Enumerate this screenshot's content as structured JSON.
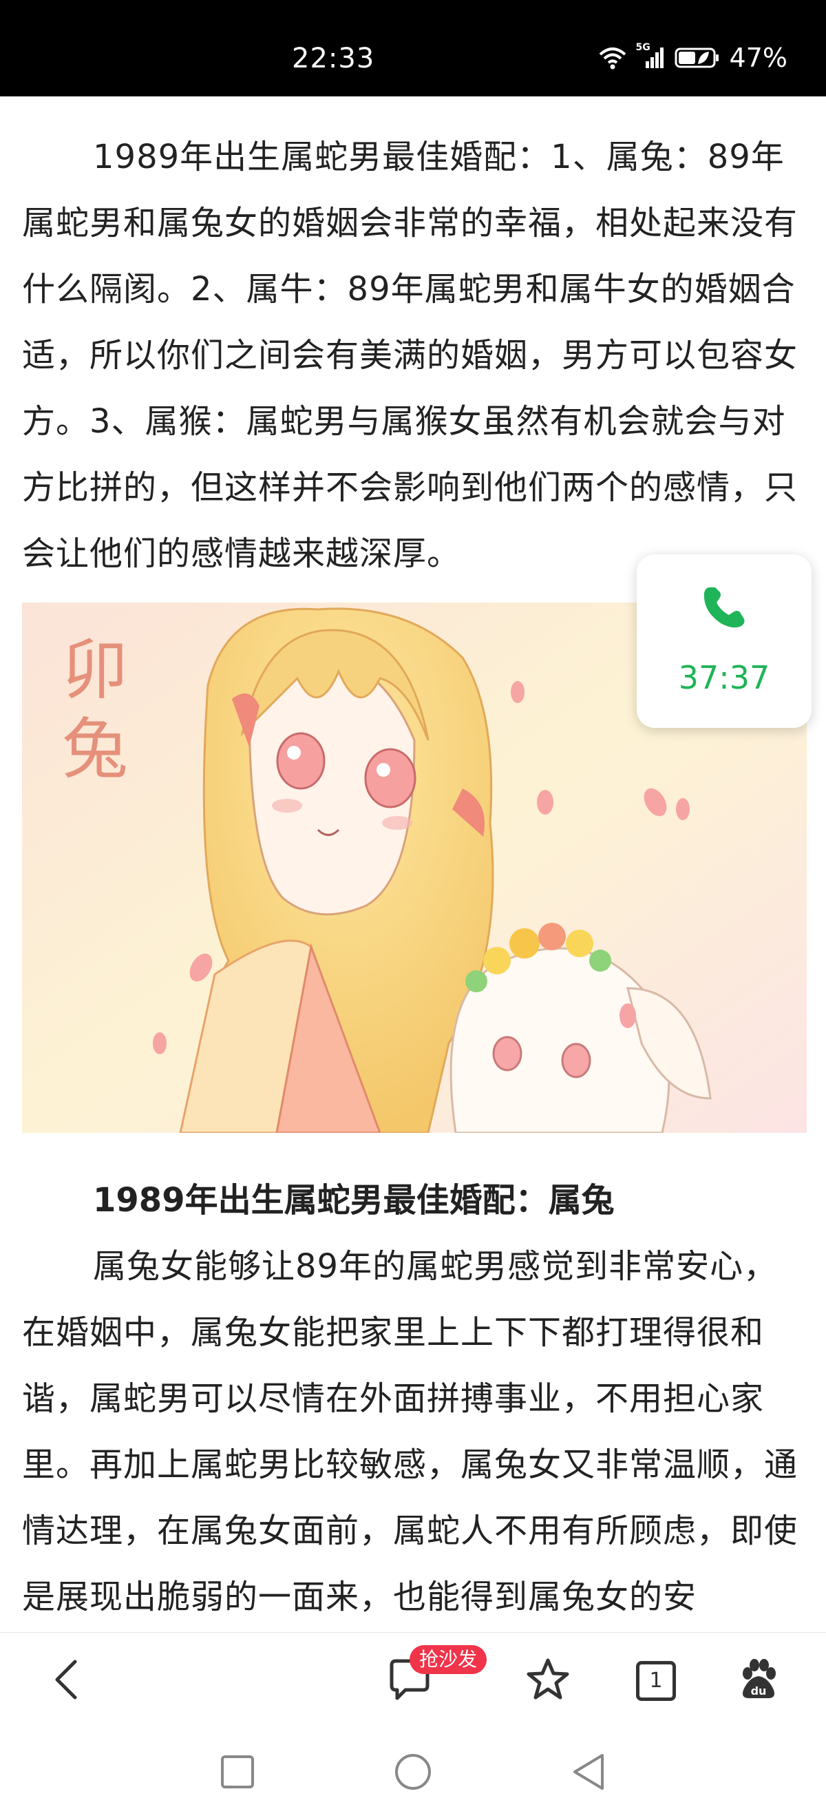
{
  "status_bar": {
    "time": "22:33",
    "network_label": "5G",
    "battery": "47%",
    "icons": [
      "wifi-icon",
      "signal-icon",
      "battery-icon"
    ]
  },
  "article": {
    "paragraph1": "1989年出生属蛇男最佳婚配：1、属兔：89年属蛇男和属兔女的婚姻会非常的幸福，相处起来没有什么隔阂。2、属牛：89年属蛇男和属牛女的婚姻合适，所以你们之间会有美满的婚姻，男方可以包容女方。3、属猴：属蛇男与属猴女虽然有机会就会与对方比拼的，但这样并不会影响到他们两个的感情，只会让他们的感情越来越深厚。",
    "image_caption_chars": [
      "卯",
      "兔"
    ],
    "heading": "1989年出生属蛇男最佳婚配：属兔",
    "paragraph2": "属兔女能够让89年的属蛇男感觉到非常安心，在婚姻中，属兔女能把家里上上下下都打理得很和谐，属蛇男可以尽情在外面拼搏事业，不用担心家里。再加上属蛇男比较敏感，属兔女又非常温顺，通情达理，在属兔女面前，属蛇人不用有所顾虑，即使是展现出脆弱的一面来，也能得到属兔女的安"
  },
  "call_widget": {
    "icon": "phone-icon",
    "duration": "37:37",
    "color": "#1fb457"
  },
  "bottom_bar": {
    "comment_badge": "抢沙发",
    "tab_count": "1",
    "icons": [
      "back-icon",
      "comment-icon",
      "star-icon",
      "tabs-icon",
      "baidu-paw-icon"
    ],
    "badge_color": "#f0344a"
  },
  "system_nav": {
    "icons": [
      "recents-square-icon",
      "home-circle-icon",
      "back-triangle-icon"
    ]
  }
}
